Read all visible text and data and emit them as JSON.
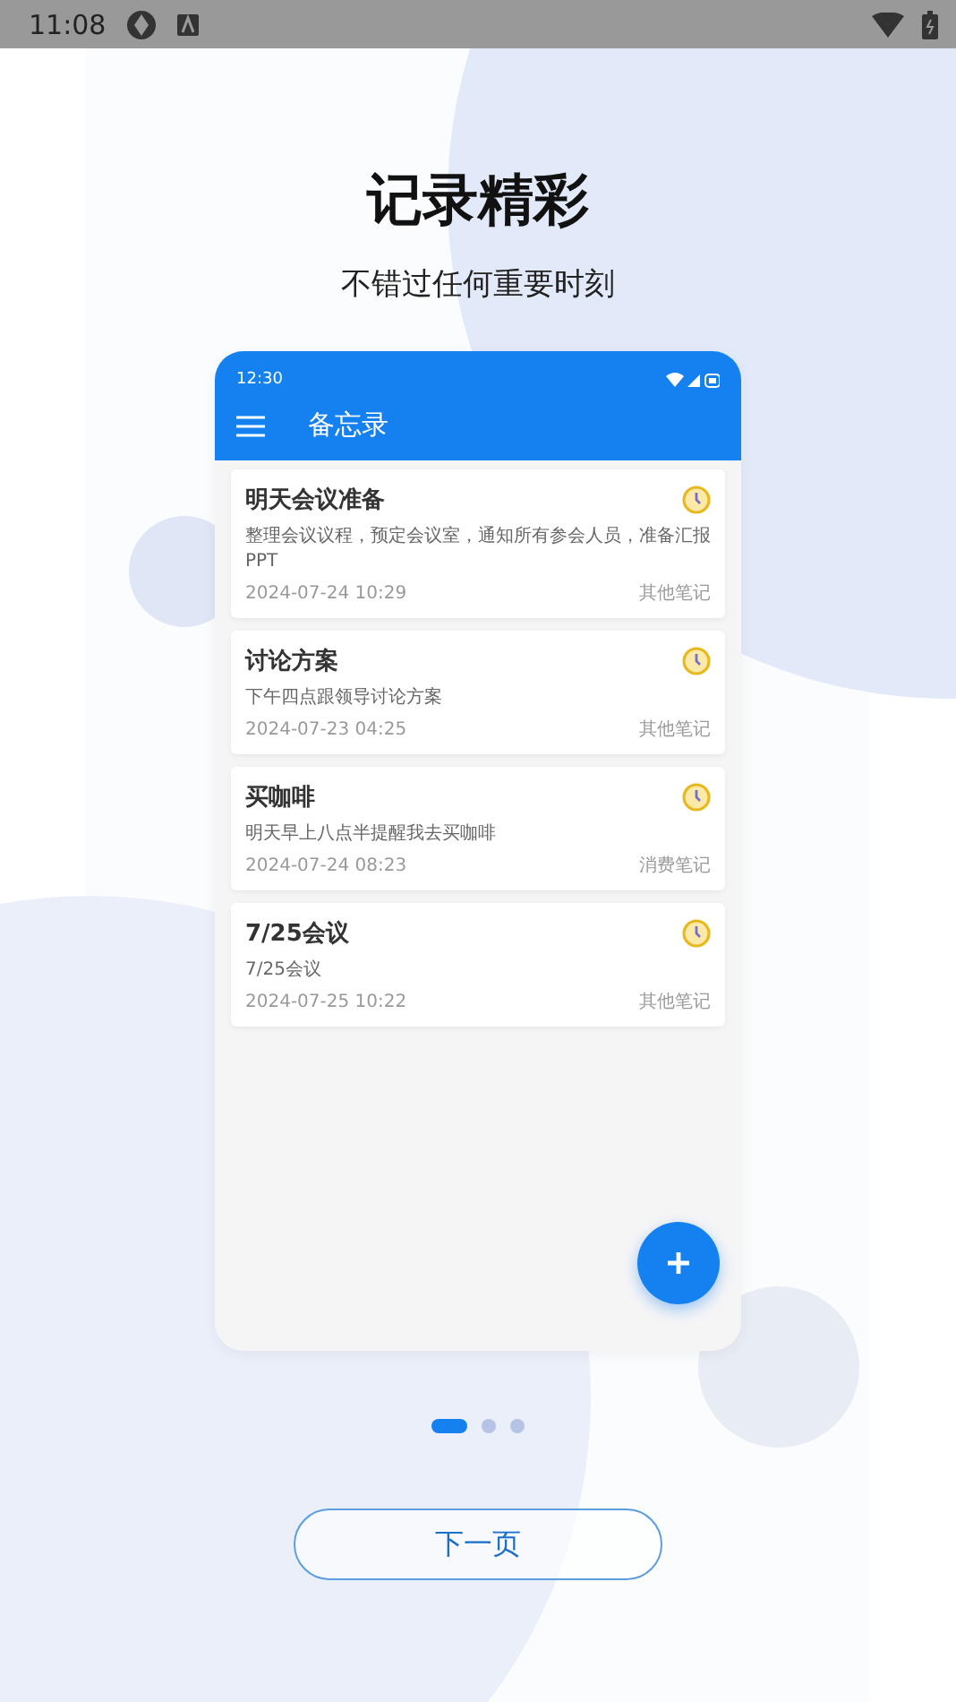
{
  "status_bar": {
    "time": "11:08"
  },
  "title": "记录精彩",
  "subtitle": "不错过任何重要时刻",
  "phone": {
    "time": "12:30",
    "app_title": "备忘录",
    "notes": [
      {
        "title": "明天会议准备",
        "body": "整理会议议程，预定会议室，通知所有参会人员，准备汇报PPT",
        "date": "2024-07-24 10:29",
        "category": "其他笔记"
      },
      {
        "title": "讨论方案",
        "body": "下午四点跟领导讨论方案",
        "date": "2024-07-23 04:25",
        "category": "其他笔记"
      },
      {
        "title": "买咖啡",
        "body": "明天早上八点半提醒我去买咖啡",
        "date": "2024-07-24 08:23",
        "category": "消费笔记"
      },
      {
        "title": "7/25会议",
        "body": "7/25会议",
        "date": "2024-07-25 10:22",
        "category": "其他笔记"
      }
    ]
  },
  "pages": [
    {
      "selected": true
    },
    {
      "selected": false
    },
    {
      "selected": false
    }
  ],
  "next_button": "下一页"
}
